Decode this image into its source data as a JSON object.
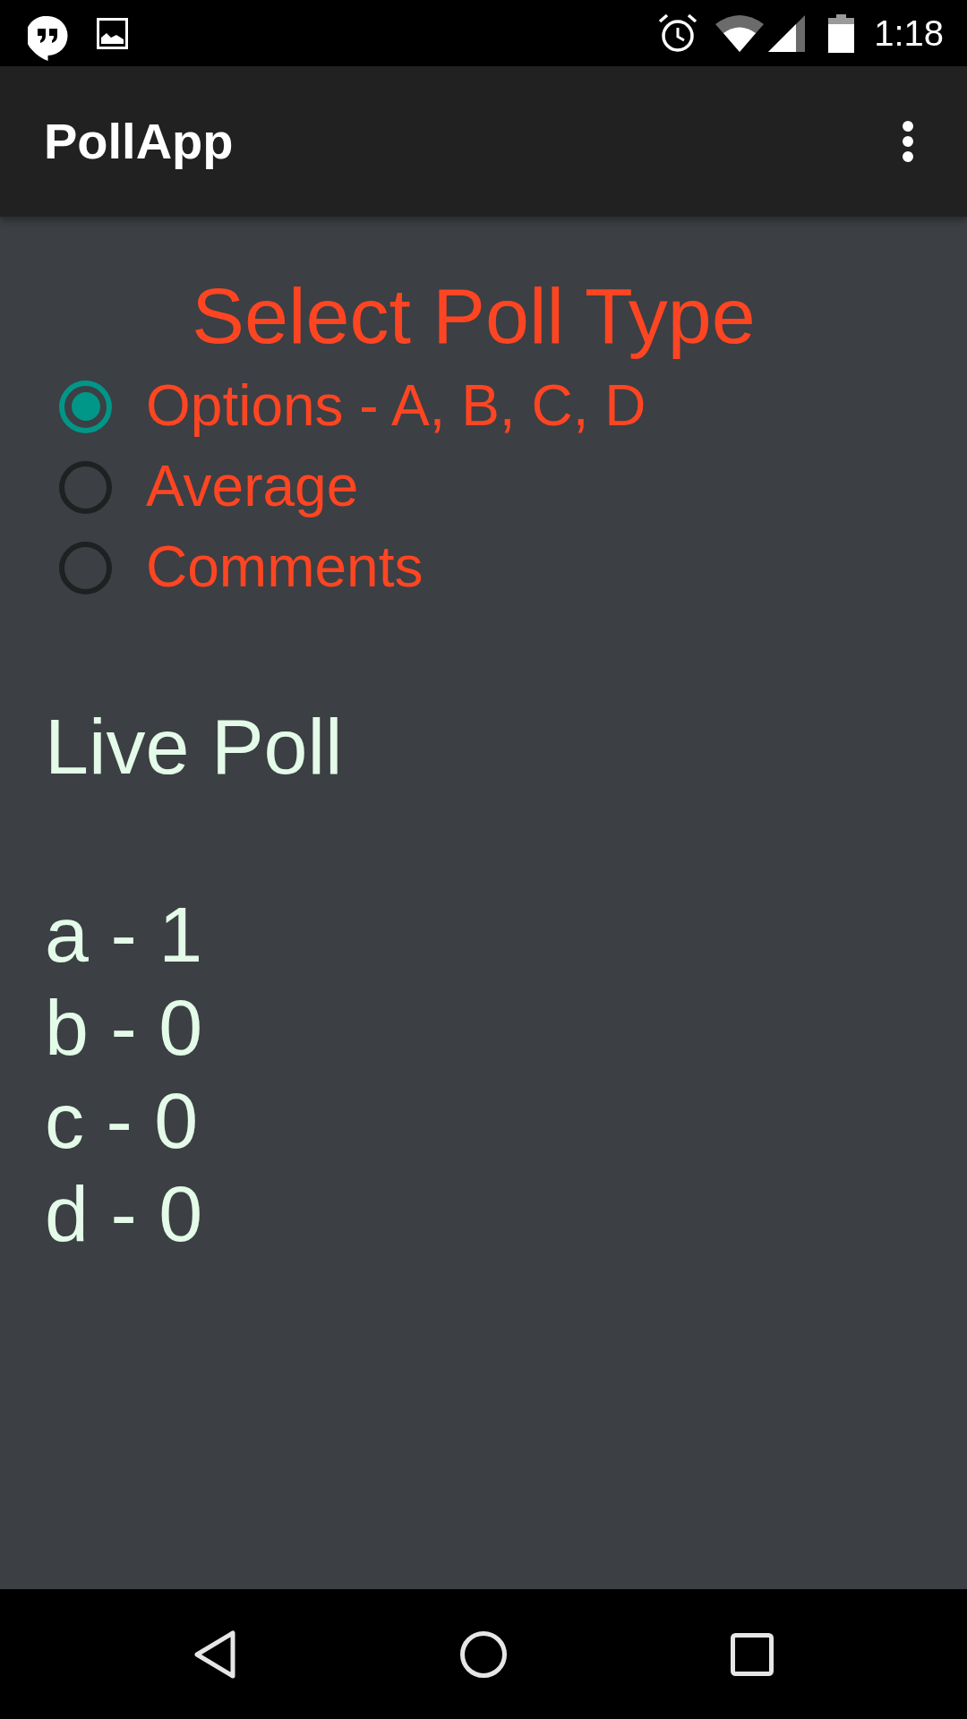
{
  "status_bar": {
    "time": "1:18"
  },
  "app_bar": {
    "title": "PollApp"
  },
  "poll_type": {
    "heading": "Select Poll Type",
    "options": [
      {
        "label": "Options - A, B, C, D",
        "selected": true
      },
      {
        "label": "Average",
        "selected": false
      },
      {
        "label": "Comments",
        "selected": false
      }
    ]
  },
  "live_poll": {
    "heading": "Live Poll",
    "results": [
      "a - 1",
      "b - 0",
      "c - 0",
      "d - 0"
    ]
  }
}
